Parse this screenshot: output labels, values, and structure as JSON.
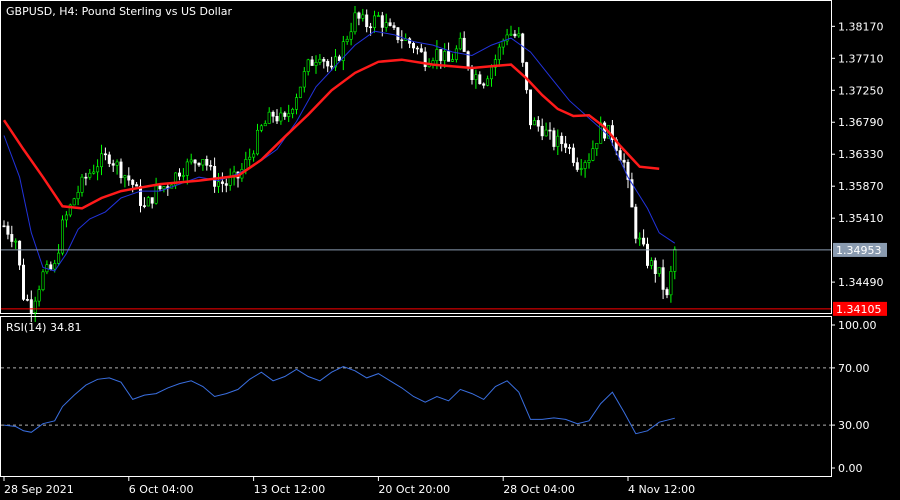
{
  "header": {
    "symbol": "GBPUSD",
    "timeframe": "H4",
    "description": "Pound Sterling vs US Dollar",
    "title_text": "GBPUSD, H4:  Pound Sterling vs US Dollar"
  },
  "colors": {
    "background": "#000000",
    "frame": "#ffffff",
    "bull_candle": "#00ff00",
    "bear_candle": "#ffffff",
    "fast_ma": "#2233dd",
    "slow_ma": "#ff1a1a",
    "bid_line": "#8a9bb0",
    "bid_tag_bg": "#8a9bb0",
    "low_line": "#ff0000",
    "low_tag_bg": "#ff0000",
    "rsi_line": "#3a6fe0",
    "rsi_level": "#b0b0b0"
  },
  "chart_data": {
    "type": "candlestick",
    "price_axis": {
      "labels": [
        "1.38170",
        "1.37710",
        "1.37250",
        "1.36790",
        "1.36330",
        "1.35870",
        "1.35410",
        "1.34490"
      ],
      "values": [
        1.3817,
        1.3771,
        1.3725,
        1.3679,
        1.3633,
        1.3587,
        1.3541,
        1.3449
      ],
      "ylim": [
        1.3406,
        1.3852
      ]
    },
    "current_price_label": "1.34953",
    "current_price": 1.34953,
    "low_line_label": "1.34105",
    "low_line_price": 1.34105,
    "time_axis": {
      "labels": [
        "28 Sep 2021",
        "6 Oct 04:00",
        "13 Oct 12:00",
        "20 Oct 20:00",
        "28 Oct 04:00",
        "4 Nov 12:00"
      ],
      "bar_index": [
        0,
        32,
        64,
        96,
        128,
        160
      ]
    },
    "close_path": [
      [
        0,
        1.353
      ],
      [
        3,
        1.351
      ],
      [
        5,
        1.343
      ],
      [
        7,
        1.3415
      ],
      [
        10,
        1.346
      ],
      [
        13,
        1.347
      ],
      [
        15,
        1.353
      ],
      [
        18,
        1.357
      ],
      [
        21,
        1.36
      ],
      [
        24,
        1.362
      ],
      [
        27,
        1.363
      ],
      [
        30,
        1.361
      ],
      [
        33,
        1.359
      ],
      [
        36,
        1.3555
      ],
      [
        39,
        1.358
      ],
      [
        42,
        1.359
      ],
      [
        45,
        1.361
      ],
      [
        48,
        1.362
      ],
      [
        51,
        1.363
      ],
      [
        54,
        1.3595
      ],
      [
        57,
        1.359
      ],
      [
        60,
        1.36
      ],
      [
        63,
        1.363
      ],
      [
        66,
        1.367
      ],
      [
        69,
        1.369
      ],
      [
        72,
        1.368
      ],
      [
        75,
        1.372
      ],
      [
        78,
        1.376
      ],
      [
        81,
        1.378
      ],
      [
        84,
        1.375
      ],
      [
        87,
        1.379
      ],
      [
        90,
        1.383
      ],
      [
        93,
        1.382
      ],
      [
        96,
        1.383
      ],
      [
        99,
        1.381
      ],
      [
        102,
        1.38
      ],
      [
        105,
        1.379
      ],
      [
        108,
        1.377
      ],
      [
        111,
        1.378
      ],
      [
        114,
        1.3765
      ],
      [
        117,
        1.379
      ],
      [
        120,
        1.375
      ],
      [
        123,
        1.374
      ],
      [
        126,
        1.377
      ],
      [
        129,
        1.381
      ],
      [
        132,
        1.38
      ],
      [
        135,
        1.368
      ],
      [
        138,
        1.367
      ],
      [
        141,
        1.365
      ],
      [
        144,
        1.365
      ],
      [
        147,
        1.362
      ],
      [
        150,
        1.363
      ],
      [
        153,
        1.367
      ],
      [
        156,
        1.366
      ],
      [
        159,
        1.362
      ],
      [
        162,
        1.352
      ],
      [
        165,
        1.348
      ],
      [
        168,
        1.346
      ],
      [
        170,
        1.3425
      ],
      [
        172,
        1.3495
      ]
    ],
    "fast_ma_path": [
      [
        0,
        1.366
      ],
      [
        4,
        1.36
      ],
      [
        7,
        1.352
      ],
      [
        10,
        1.347
      ],
      [
        13,
        1.3465
      ],
      [
        16,
        1.349
      ],
      [
        19,
        1.3525
      ],
      [
        22,
        1.354
      ],
      [
        26,
        1.355
      ],
      [
        30,
        1.357
      ],
      [
        35,
        1.358
      ],
      [
        40,
        1.358
      ],
      [
        45,
        1.359
      ],
      [
        50,
        1.36
      ],
      [
        55,
        1.3595
      ],
      [
        60,
        1.3605
      ],
      [
        65,
        1.362
      ],
      [
        70,
        1.364
      ],
      [
        75,
        1.368
      ],
      [
        80,
        1.373
      ],
      [
        85,
        1.376
      ],
      [
        90,
        1.379
      ],
      [
        95,
        1.381
      ],
      [
        100,
        1.3805
      ],
      [
        105,
        1.3795
      ],
      [
        110,
        1.379
      ],
      [
        115,
        1.378
      ],
      [
        120,
        1.3775
      ],
      [
        125,
        1.379
      ],
      [
        130,
        1.38
      ],
      [
        135,
        1.378
      ],
      [
        140,
        1.3745
      ],
      [
        145,
        1.371
      ],
      [
        150,
        1.3685
      ],
      [
        155,
        1.366
      ],
      [
        160,
        1.36
      ],
      [
        165,
        1.3555
      ],
      [
        168,
        1.352
      ],
      [
        172,
        1.3505
      ]
    ],
    "slow_ma_path": [
      [
        0,
        1.3682
      ],
      [
        5,
        1.364
      ],
      [
        10,
        1.36
      ],
      [
        15,
        1.3558
      ],
      [
        20,
        1.3555
      ],
      [
        25,
        1.357
      ],
      [
        30,
        1.358
      ],
      [
        40,
        1.359
      ],
      [
        50,
        1.3595
      ],
      [
        60,
        1.3602
      ],
      [
        66,
        1.3625
      ],
      [
        72,
        1.3658
      ],
      [
        78,
        1.369
      ],
      [
        84,
        1.3725
      ],
      [
        90,
        1.375
      ],
      [
        96,
        1.3766
      ],
      [
        102,
        1.3769
      ],
      [
        110,
        1.3762
      ],
      [
        120,
        1.3757
      ],
      [
        126,
        1.376
      ],
      [
        130,
        1.3762
      ],
      [
        134,
        1.3742
      ],
      [
        138,
        1.3718
      ],
      [
        142,
        1.3698
      ],
      [
        146,
        1.3688
      ],
      [
        150,
        1.3689
      ],
      [
        154,
        1.3672
      ],
      [
        158,
        1.3645
      ],
      [
        163,
        1.3615
      ],
      [
        168,
        1.3612
      ]
    ],
    "rsi": {
      "label": "RSI(14) 34.81",
      "name": "RSI(14)",
      "value": 34.81,
      "ylim": [
        0,
        100
      ],
      "axis_labels": [
        "100.00",
        "70.00",
        "30.00",
        "0.00"
      ],
      "axis_values": [
        100,
        70,
        30,
        0
      ],
      "levels": [
        70,
        30
      ],
      "path": [
        [
          0,
          30
        ],
        [
          3,
          29
        ],
        [
          5,
          26
        ],
        [
          7,
          25
        ],
        [
          10,
          31
        ],
        [
          13,
          33
        ],
        [
          15,
          43
        ],
        [
          18,
          51
        ],
        [
          21,
          58
        ],
        [
          24,
          62
        ],
        [
          27,
          63
        ],
        [
          30,
          60
        ],
        [
          33,
          48
        ],
        [
          36,
          51
        ],
        [
          39,
          52
        ],
        [
          42,
          56
        ],
        [
          45,
          59
        ],
        [
          48,
          61
        ],
        [
          51,
          57
        ],
        [
          54,
          50
        ],
        [
          57,
          52
        ],
        [
          60,
          55
        ],
        [
          63,
          62
        ],
        [
          66,
          67
        ],
        [
          69,
          61
        ],
        [
          72,
          64
        ],
        [
          75,
          69
        ],
        [
          78,
          64
        ],
        [
          81,
          61
        ],
        [
          84,
          67
        ],
        [
          87,
          71
        ],
        [
          90,
          68
        ],
        [
          93,
          63
        ],
        [
          96,
          66
        ],
        [
          99,
          61
        ],
        [
          102,
          56
        ],
        [
          105,
          50
        ],
        [
          108,
          46
        ],
        [
          111,
          50
        ],
        [
          114,
          47
        ],
        [
          117,
          55
        ],
        [
          120,
          52
        ],
        [
          123,
          48
        ],
        [
          126,
          57
        ],
        [
          129,
          61
        ],
        [
          132,
          53
        ],
        [
          135,
          34
        ],
        [
          138,
          34
        ],
        [
          141,
          35
        ],
        [
          144,
          34
        ],
        [
          147,
          31
        ],
        [
          150,
          33
        ],
        [
          153,
          45
        ],
        [
          156,
          53
        ],
        [
          159,
          39
        ],
        [
          162,
          24
        ],
        [
          165,
          26
        ],
        [
          168,
          32
        ],
        [
          172,
          34.8
        ]
      ]
    }
  }
}
